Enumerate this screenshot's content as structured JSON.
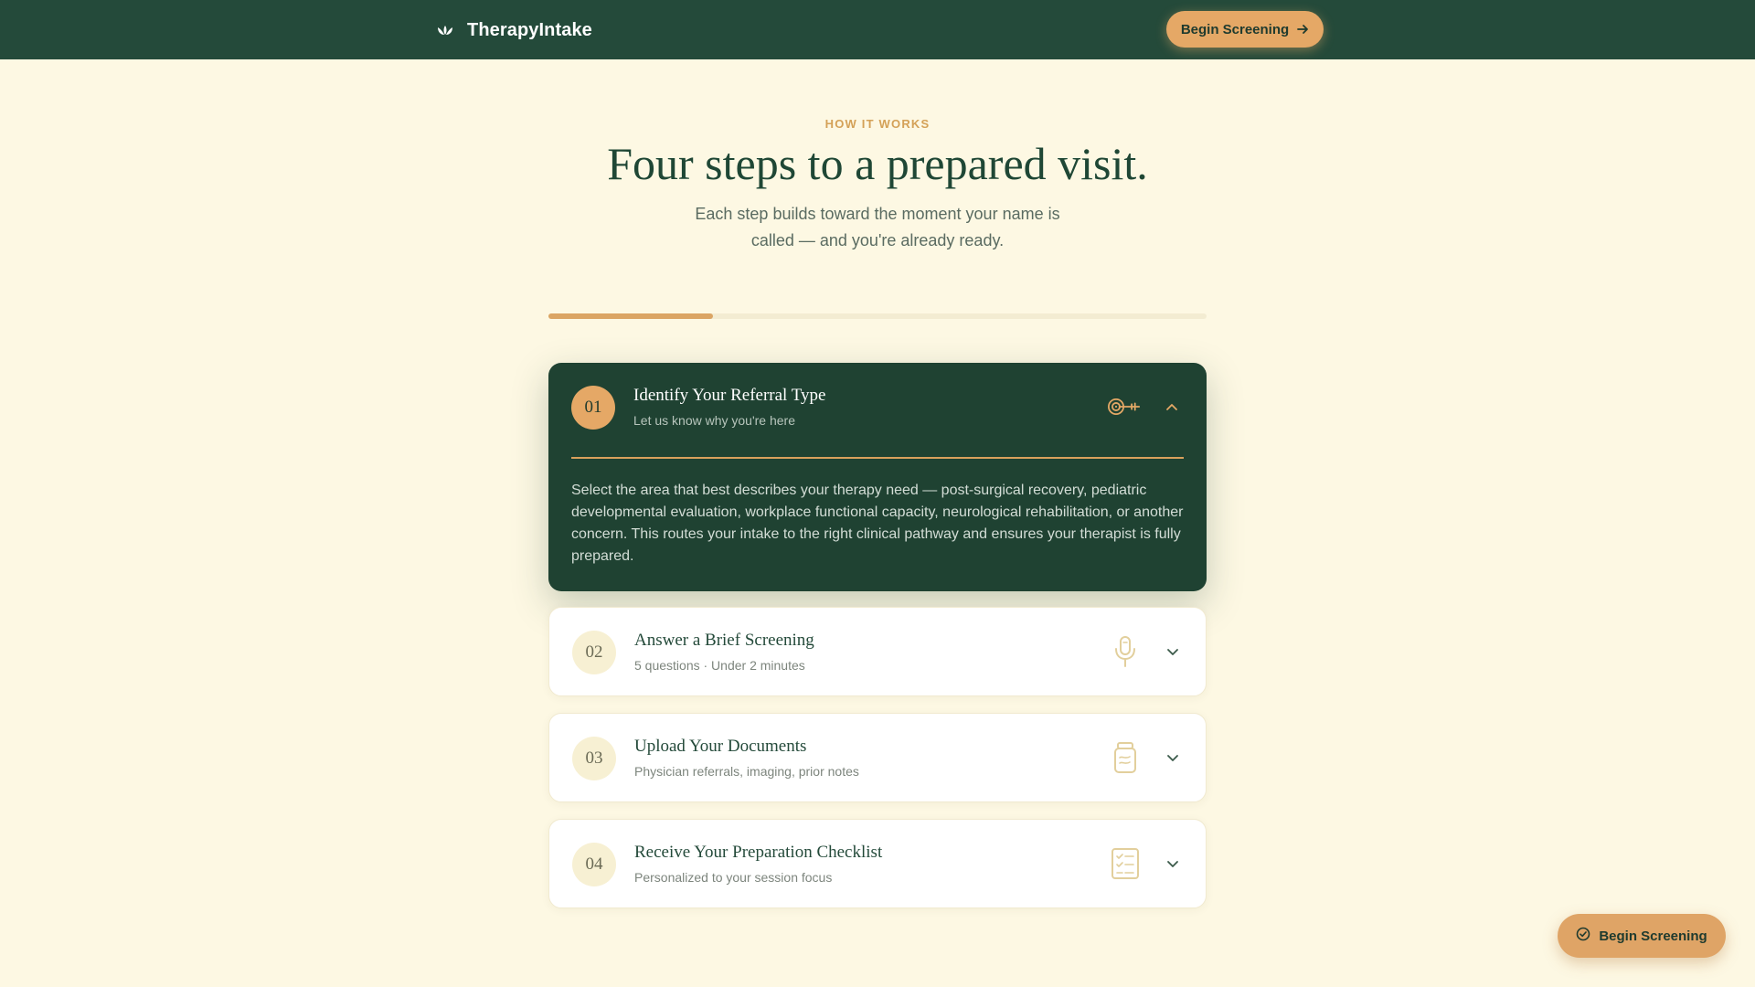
{
  "brand": {
    "name": "TherapyIntake",
    "icon": "lotus-icon"
  },
  "header": {
    "cta_label": "Begin Screening",
    "cta_icon": "arrow-right-icon"
  },
  "hero": {
    "eyebrow": "HOW IT WORKS",
    "title": "Four steps to a prepared visit.",
    "subtitle": "Each step builds toward the moment your name is called — and you're already ready."
  },
  "progress": {
    "fraction": 0.25
  },
  "steps": [
    {
      "number": "01",
      "title": "Identify Your Referral Type",
      "description": "Let us know why you're here",
      "icon": "target-arrow-icon",
      "expanded": true,
      "body": "Select the area that best describes your therapy need — post-surgical recovery, pediatric developmental evaluation, workplace functional capacity, neurological rehabilitation, or another concern. This routes your intake to the right clinical pathway and ensures your therapist is fully prepared."
    },
    {
      "number": "02",
      "title": "Answer a Brief Screening",
      "description": "5 questions · Under 2 minutes",
      "icon": "microphone-icon",
      "expanded": false
    },
    {
      "number": "03",
      "title": "Upload Your Documents",
      "description": "Physician referrals, imaging, prior notes",
      "icon": "document-jar-icon",
      "expanded": false
    },
    {
      "number": "04",
      "title": "Receive Your Preparation Checklist",
      "description": "Personalized to your session focus",
      "icon": "checklist-icon",
      "expanded": false
    }
  ],
  "floating_cta": {
    "label": "Begin Screening",
    "icon": "check-circle-icon"
  },
  "colors": {
    "header_bg": "#244a3a",
    "page_bg": "#fdf8e3",
    "accent": "#e5a866",
    "active_card_bg": "#1f4232"
  }
}
